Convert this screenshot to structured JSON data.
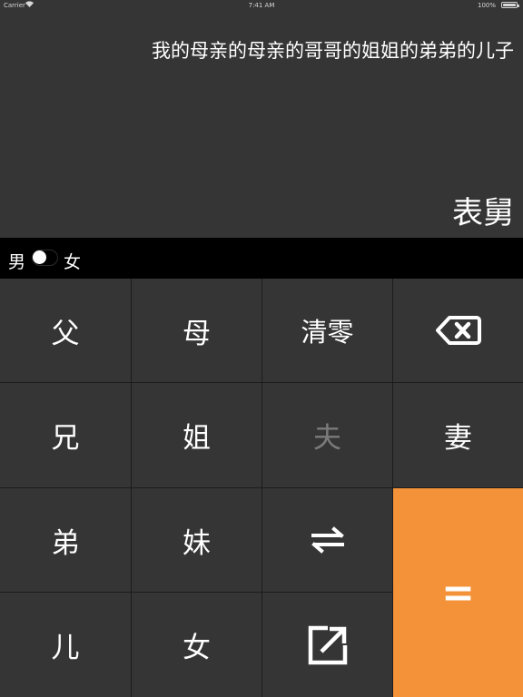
{
  "status_bar": {
    "carrier": "Carrier",
    "time": "7:41 AM",
    "battery": "100%"
  },
  "display": {
    "expression": "我的母亲的母亲的哥哥的姐姐的弟弟的儿子",
    "result": "表舅"
  },
  "gender": {
    "male_label": "男",
    "female_label": "女",
    "selected": "男"
  },
  "keys": {
    "father": "父",
    "mother": "母",
    "clear": "清零",
    "elder_brother": "兄",
    "elder_sister": "姐",
    "husband": "夫",
    "wife": "妻",
    "younger_brother": "弟",
    "younger_sister": "妹",
    "son": "儿",
    "daughter": "女",
    "equals": "="
  },
  "icons": {
    "backspace": "backspace-icon",
    "swap": "swap-arrows-icon",
    "share": "share-icon"
  },
  "colors": {
    "background": "#353535",
    "gender_bar": "#000000",
    "equals_key": "#f39238",
    "disabled_text": "#7a7a7a"
  }
}
